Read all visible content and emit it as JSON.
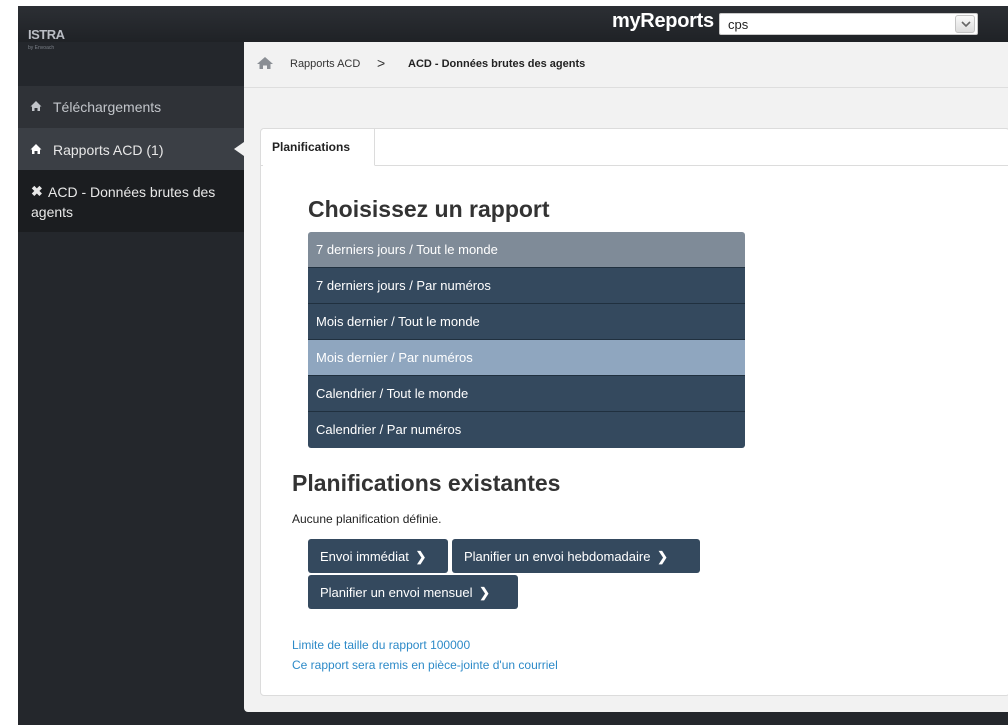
{
  "header": {
    "brand": "ISTRA",
    "brand_sub": "by Envoach",
    "app_title": "myReports",
    "select_value": "cps",
    "select_arrow_icon": "chevron-down-icon"
  },
  "sidebar": {
    "items": [
      {
        "icon": "home-icon",
        "label": "Téléchargements"
      },
      {
        "icon": "home-icon",
        "label": "Rapports ACD (1)"
      },
      {
        "icon": "close-icon",
        "label": "ACD - Données brutes des agents"
      }
    ]
  },
  "breadcrumb": {
    "home_icon": "home-icon",
    "link": "Rapports ACD",
    "separator": ">",
    "current": "ACD - Données brutes des agents"
  },
  "tabs": [
    {
      "label": "Planifications"
    }
  ],
  "main": {
    "choose_title": "Choisissez un rapport",
    "reports": [
      {
        "label": "7 derniers jours / Tout le monde"
      },
      {
        "label": "7 derniers jours / Par numéros"
      },
      {
        "label": "Mois dernier / Tout le monde"
      },
      {
        "label": "Mois dernier / Par numéros"
      },
      {
        "label": "Calendrier / Tout le monde"
      },
      {
        "label": "Calendrier / Par numéros"
      }
    ],
    "existing_title": "Planifications existantes",
    "no_plan_text": "Aucune planification définie.",
    "buttons": {
      "immediate": "Envoi immédiat",
      "weekly": "Planifier un envoi hebdomadaire",
      "monthly": "Planifier un envoi mensuel",
      "chevron": "❯"
    },
    "info_size": "Limite de taille du rapport 100000",
    "info_attach": "Ce rapport sera remis en pièce-jointe d'un courriel"
  },
  "colors": {
    "navy": "#34495e",
    "hover_row": "#7f8b98",
    "selected_row": "#8fa6bf",
    "link": "#2d8ac8"
  }
}
